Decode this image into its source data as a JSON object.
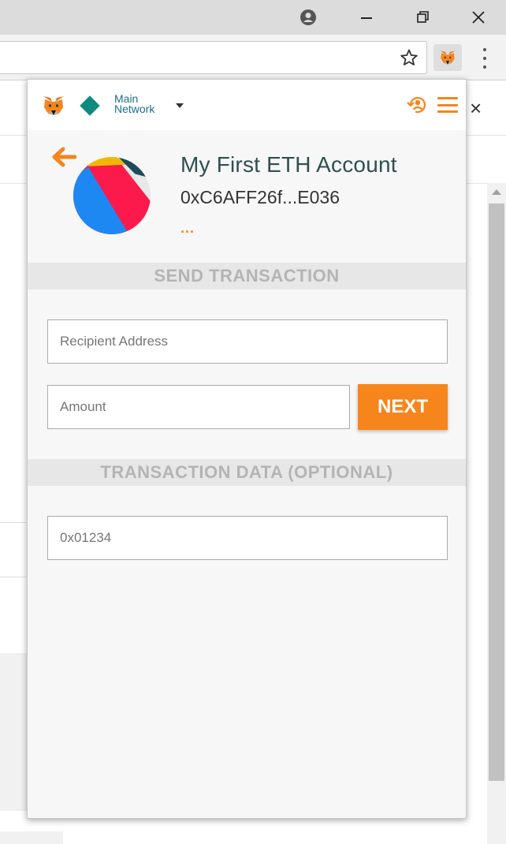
{
  "browser": {
    "account_icon": "account-circle-icon",
    "minimize_icon": "minimize-icon",
    "restore_icon": "restore-icon",
    "close_icon": "close-icon",
    "bookmark_icon": "star-icon",
    "extension_icon": "metamask-fox-icon",
    "menu_icon": "kebab-menu-icon"
  },
  "background_page": {
    "close_glyph": "×"
  },
  "popup": {
    "network": {
      "line1": "Main",
      "line2": "Network",
      "color": "#0f8a7e"
    },
    "account": {
      "name": "My First ETH Account",
      "address": "0xC6AFF26f...E036",
      "more": "..."
    },
    "send_section_title": "SEND TRANSACTION",
    "recipient_placeholder": "Recipient Address",
    "amount_placeholder": "Amount",
    "next_button": "NEXT",
    "data_section_title": "TRANSACTION DATA (OPTIONAL)",
    "data_placeholder": "0x01234"
  },
  "colors": {
    "accent": "#f6851b",
    "network": "#0f8a7e",
    "title_text": "#2f4f4f"
  }
}
